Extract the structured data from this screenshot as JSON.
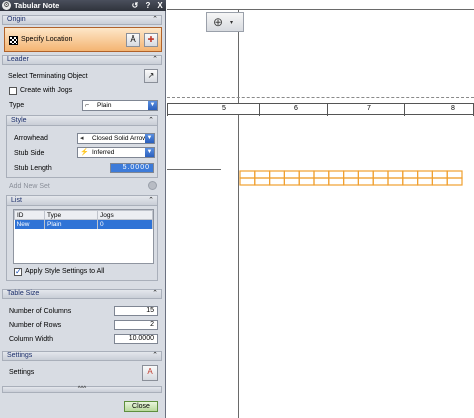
{
  "dialog": {
    "title": "Tabular Note",
    "help_glyph": "?",
    "close_glyph": "X",
    "colors": {
      "title_bg": "#2f333c",
      "origin_highlight": "#f4b472",
      "selection": "#2f73d6",
      "close_button": "#b9d99c"
    }
  },
  "origin": {
    "header": "Origin",
    "specify_location": "Specify Location"
  },
  "leader": {
    "header": "Leader",
    "select_terminating_object": "Select Terminating Object",
    "create_with_jogs": "Create with Jogs",
    "create_with_jogs_checked": false,
    "type_label": "Type",
    "type_value": "Plain",
    "style": {
      "header": "Style",
      "arrowhead_label": "Arrowhead",
      "arrowhead_value": "Closed Solid Arrow",
      "stub_side_label": "Stub Side",
      "stub_side_value": "Inferred",
      "stub_length_label": "Stub Length",
      "stub_length_value": "5.0000"
    },
    "add_new_set": "Add New Set",
    "list": {
      "header": "List",
      "columns": [
        "ID",
        "Type",
        "Jogs"
      ],
      "rows": [
        {
          "id": "New",
          "type": "Plain",
          "jogs": "0"
        }
      ]
    },
    "apply_style_settings": "Apply Style Settings to All",
    "apply_style_settings_checked": true
  },
  "table_size": {
    "header": "Table Size",
    "columns_label": "Number of Columns",
    "columns_value": "15",
    "rows_label": "Number of Rows",
    "rows_value": "2",
    "column_width_label": "Column Width",
    "column_width_value": "10.0000"
  },
  "settings": {
    "header": "Settings",
    "settings_label": "Settings"
  },
  "footer": {
    "expand_glyph": "^^^",
    "close_label": "Close"
  },
  "canvas": {
    "ruler_numbers": [
      "5",
      "6",
      "7",
      "8"
    ],
    "preview_table": {
      "columns": 15,
      "rows": 2,
      "color": "#f0a030"
    }
  }
}
